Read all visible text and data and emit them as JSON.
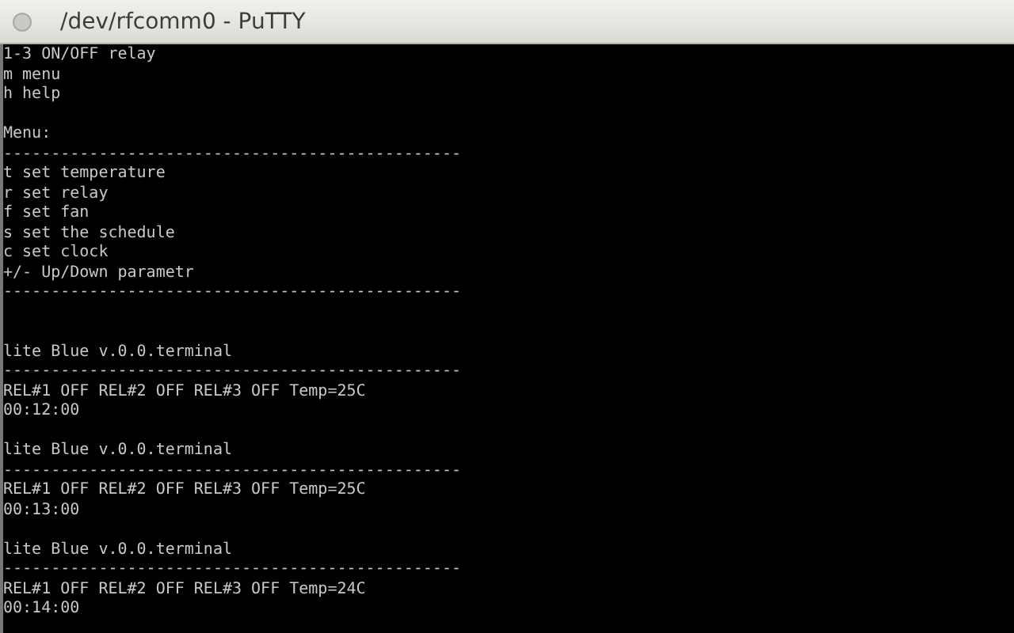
{
  "window": {
    "title": "/dev/rfcomm0 - PuTTY"
  },
  "terminal": {
    "lines": [
      {
        "kind": "text",
        "text": "1-3 ON/OFF relay"
      },
      {
        "kind": "text",
        "text": "m menu"
      },
      {
        "kind": "text",
        "text": "h help"
      },
      {
        "kind": "blank"
      },
      {
        "kind": "text",
        "text": "Menu:"
      },
      {
        "kind": "text",
        "text": "------------------------------------------------"
      },
      {
        "kind": "text",
        "text": "t set temperature"
      },
      {
        "kind": "text",
        "text": "r set relay"
      },
      {
        "kind": "text",
        "text": "f set fan"
      },
      {
        "kind": "text",
        "text": "s set the schedule"
      },
      {
        "kind": "text",
        "text": "c set clock"
      },
      {
        "kind": "text",
        "text": "+/- Up/Down parametr"
      },
      {
        "kind": "text",
        "text": "------------------------------------------------"
      },
      {
        "kind": "blank"
      },
      {
        "kind": "blank"
      },
      {
        "kind": "text",
        "text": "lite Blue v.0.0.terminal"
      },
      {
        "kind": "text",
        "text": "------------------------------------------------"
      },
      {
        "kind": "text",
        "text": "REL#1 OFF REL#2 OFF REL#3 OFF Temp=25C"
      },
      {
        "kind": "text",
        "text": "00:12:00"
      },
      {
        "kind": "blank"
      },
      {
        "kind": "text",
        "text": "lite Blue v.0.0.terminal"
      },
      {
        "kind": "text",
        "text": "------------------------------------------------"
      },
      {
        "kind": "text",
        "text": "REL#1 OFF REL#2 OFF REL#3 OFF Temp=25C"
      },
      {
        "kind": "text",
        "text": "00:13:00"
      },
      {
        "kind": "blank"
      },
      {
        "kind": "text",
        "text": "lite Blue v.0.0.terminal"
      },
      {
        "kind": "text",
        "text": "------------------------------------------------"
      },
      {
        "kind": "text",
        "text": "REL#1 OFF REL#2 OFF REL#3 OFF Temp=24C"
      },
      {
        "kind": "text",
        "text": "00:14:00"
      }
    ]
  }
}
